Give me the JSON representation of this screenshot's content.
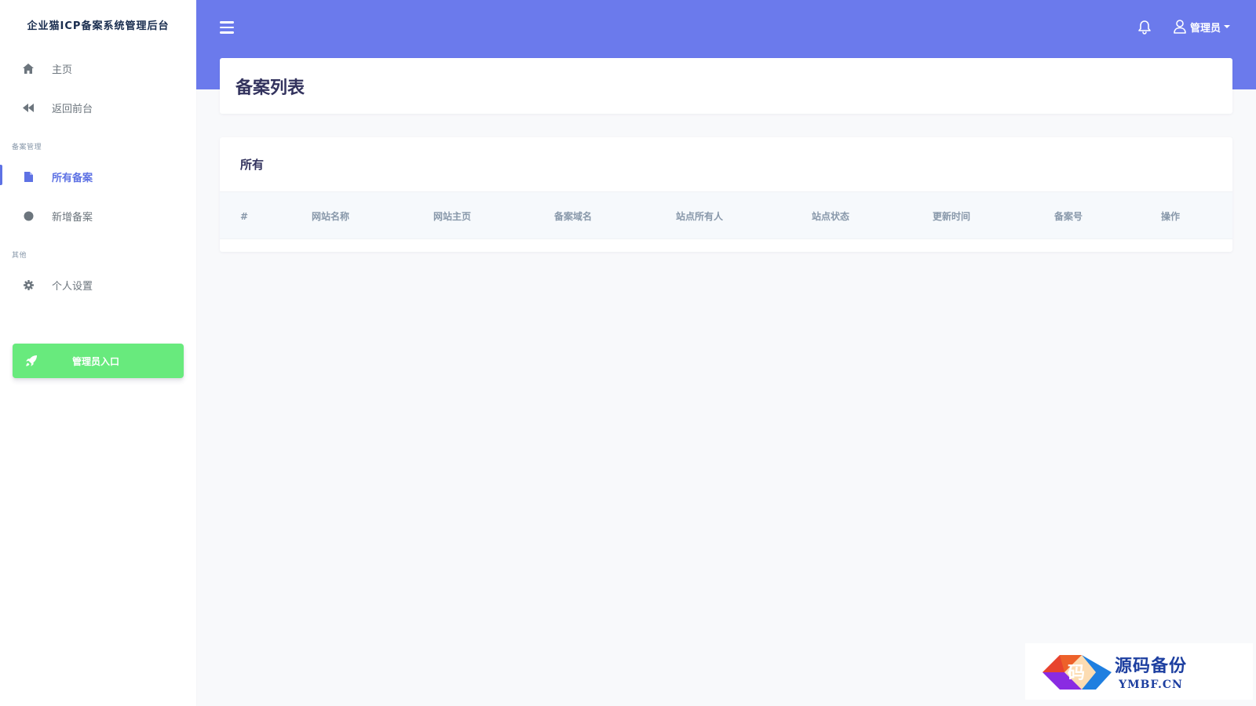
{
  "sidebar": {
    "brand": "企业猫ICP备案系统管理后台",
    "items_top": [
      {
        "label": "主页",
        "icon": "home-icon"
      },
      {
        "label": "返回前台",
        "icon": "backward-icon"
      }
    ],
    "section_filing": "备案管理",
    "items_filing": [
      {
        "label": "所有备案",
        "icon": "file-icon",
        "active": true
      },
      {
        "label": "新增备案",
        "icon": "circle-icon"
      }
    ],
    "section_other": "其他",
    "items_other": [
      {
        "label": "个人设置",
        "icon": "gear-icon"
      }
    ],
    "admin_button": "管理员入口"
  },
  "topbar": {
    "user_name": "管理员",
    "accent": "#6b7aec"
  },
  "page": {
    "title": "备案列表"
  },
  "table": {
    "header": "所有",
    "columns": [
      "#",
      "网站名称",
      "网站主页",
      "备案域名",
      "站点所有人",
      "站点状态",
      "更新时间",
      "备案号",
      "操作"
    ]
  },
  "watermark": {
    "logo_text": "码",
    "cn": "源码备份",
    "en": "YMBF.CN"
  }
}
